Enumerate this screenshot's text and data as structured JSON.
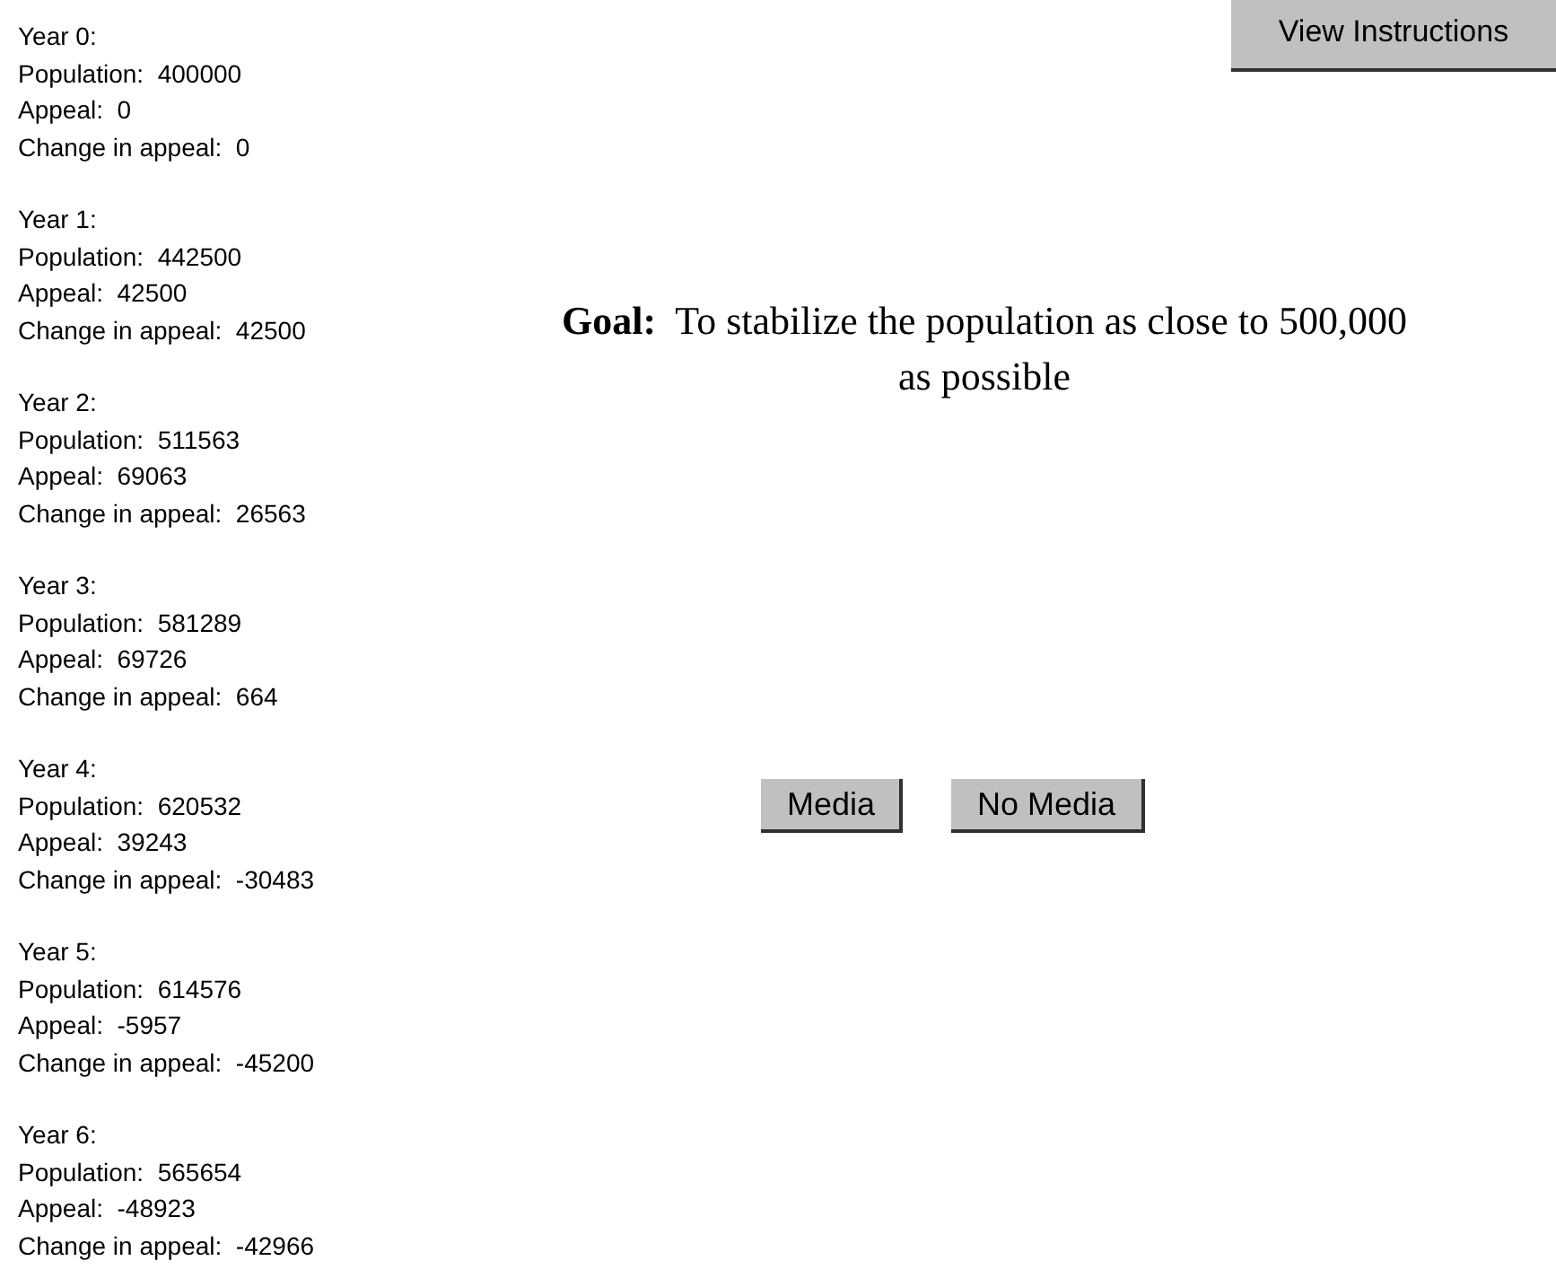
{
  "years": [
    {
      "heading": "Year 0:",
      "lines": [
        "Population:  400000",
        "Appeal:  0",
        "Change in appeal:  0"
      ]
    },
    {
      "heading": "Year 1:",
      "lines": [
        "Population:  442500",
        "Appeal:  42500",
        "Change in appeal:  42500"
      ]
    },
    {
      "heading": "Year 2:",
      "lines": [
        "Population:  511563",
        "Appeal:  69063",
        "Change in appeal:  26563"
      ]
    },
    {
      "heading": "Year 3:",
      "lines": [
        "Population:  581289",
        "Appeal:  69726",
        "Change in appeal:  664"
      ]
    },
    {
      "heading": "Year 4:",
      "lines": [
        "Population:  620532",
        "Appeal:  39243",
        "Change in appeal:  -30483"
      ]
    },
    {
      "heading": "Year 5:",
      "lines": [
        "Population:  614576",
        "Appeal:  -5957",
        "Change in appeal:  -45200"
      ]
    },
    {
      "heading": "Year 6:",
      "lines": [
        "Population:  565654",
        "Appeal:  -48923",
        "Change in appeal:  -42966"
      ]
    }
  ],
  "instructions_button": "View Instructions",
  "goal": "**Goal:**  To stabilize the population as close to 500,000 as possible",
  "choice_buttons": [
    "Media",
    "No Media"
  ]
}
